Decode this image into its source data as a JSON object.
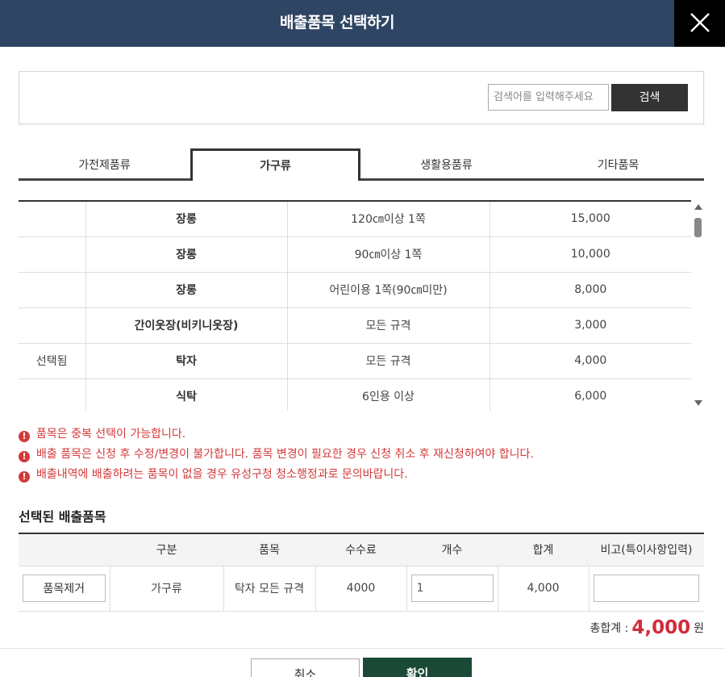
{
  "dialog": {
    "title": "배출품목 선택하기",
    "close_icon": "close-icon"
  },
  "search": {
    "placeholder": "검색어를 입력해주세요",
    "button_label": "검색"
  },
  "tabs": [
    {
      "label": "가전제품류",
      "active": false
    },
    {
      "label": "가구류",
      "active": true
    },
    {
      "label": "생활용품류",
      "active": false
    },
    {
      "label": "기타품목",
      "active": false
    }
  ],
  "item_list": [
    {
      "status": "",
      "name": "장롱",
      "spec": "120㎝이상 1쪽",
      "fee": "15,000"
    },
    {
      "status": "",
      "name": "장롱",
      "spec": "90㎝이상 1쪽",
      "fee": "10,000"
    },
    {
      "status": "",
      "name": "장롱",
      "spec": "어린이용 1쪽(90㎝미만)",
      "fee": "8,000"
    },
    {
      "status": "",
      "name": "간이옷장(비키니옷장)",
      "spec": "모든 규격",
      "fee": "3,000"
    },
    {
      "status": "선택됨",
      "name": "탁자",
      "spec": "모든 규격",
      "fee": "4,000"
    },
    {
      "status": "",
      "name": "식탁",
      "spec": "6인용 이상",
      "fee": "6,000"
    }
  ],
  "notices": [
    "품목은 중복 선택이 가능합니다.",
    "배출 품목은 신청 후 수정/변경이 불가합니다. 품목 변경이 필요한 경우 신청 취소 후 재신청하여야 합니다.",
    "배출내역에 배출하려는 품목이 없을 경우 유성구청 청소행정과로 문의바랍니다."
  ],
  "selected": {
    "title": "선택된 배출품목",
    "headers": [
      "",
      "구분",
      "품목",
      "수수료",
      "개수",
      "합계",
      "비고(특이사항입력)"
    ],
    "rows": [
      {
        "remove_label": "품목제거",
        "category": "가구류",
        "item": "탁자 모든 규격",
        "fee": "4000",
        "count": "1",
        "sum": "4,000",
        "note": ""
      }
    ],
    "total_label": "총합계 :",
    "total_amount": "4,000",
    "total_unit": "원"
  },
  "footer": {
    "cancel_label": "취소",
    "confirm_label": "확인"
  },
  "colors": {
    "header_bg": "#2f4564",
    "notice": "#d33a3a",
    "total": "#d12c3a",
    "confirm_bg": "#1a4a36"
  }
}
